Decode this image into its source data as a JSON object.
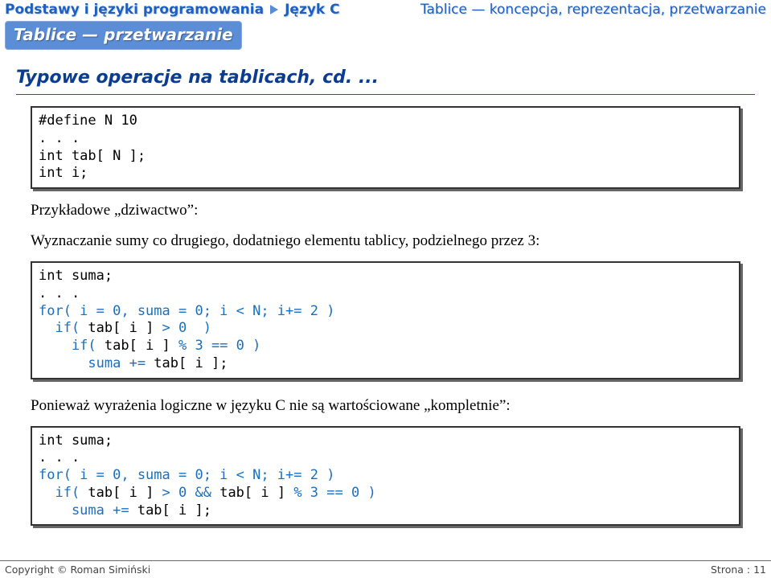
{
  "header": {
    "left1": "Podstawy i języki programowania",
    "left2": "Język C",
    "right": "Tablice — koncepcja, reprezentacja, przetwarzanie"
  },
  "subheader": "Tablice — przetwarzanie",
  "section_title": "Typowe operacje na tablicach, cd. ...",
  "code1": {
    "l1": "#define N 10",
    "l2": ". . .",
    "l3": "int tab[ N ];",
    "l4": "int i;"
  },
  "para1": "Przykładowe „dziwactwo”:",
  "para2": "Wyznaczanie sumy co drugiego, dodatniego elementu tablicy, podzielnego przez 3:",
  "code2": {
    "l1": "int suma;",
    "l2": ". . .",
    "l3a": "for( i = 0, suma = 0; i < N; i+= 2 )",
    "l4a": "  if( ",
    "l4b": "tab[ i ]",
    "l4c": " > 0  )",
    "l5a": "    if( ",
    "l5b": "tab[ i ]",
    "l5c": " % 3 == 0 )",
    "l6a": "      suma += ",
    "l6b": "tab[ i ]",
    "l6c": ";"
  },
  "para3": "Ponieważ wyrażenia logiczne w języku C nie są wartościowane „kompletnie”:",
  "code3": {
    "l1": "int suma;",
    "l2": ". . .",
    "l3a": "for( i = 0, suma = 0; i < N; i+= 2 )",
    "l4a": "  if( ",
    "l4b": "tab[ i ]",
    "l4c": " > 0 && ",
    "l4d": "tab[ i ]",
    "l4e": " % 3 == 0 )",
    "l5a": "    suma += ",
    "l5b": "tab[ i ]",
    "l5c": ";"
  },
  "footer": {
    "left": "Copyright © Roman Simiński",
    "right": "Strona : 11"
  }
}
